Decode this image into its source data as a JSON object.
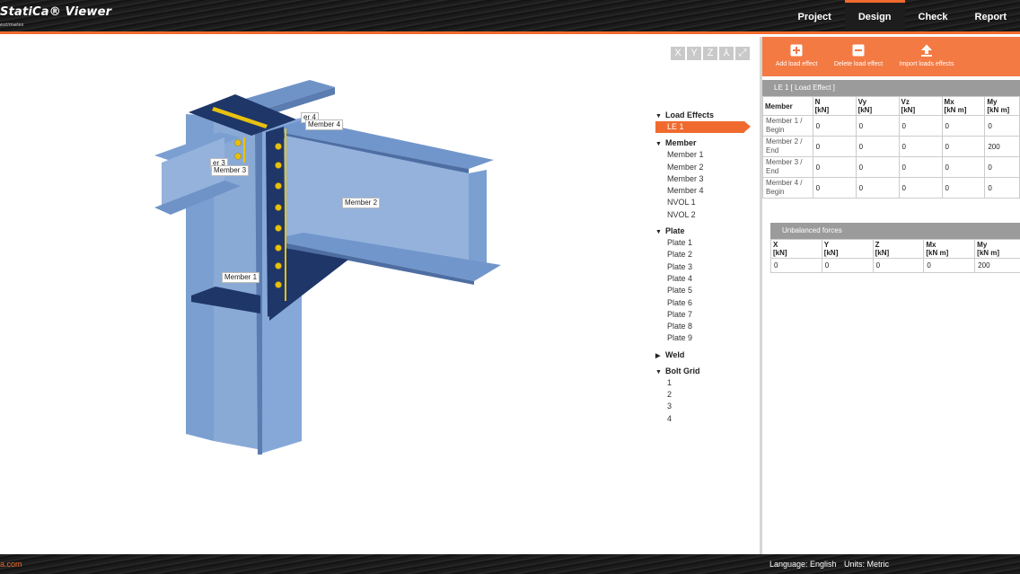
{
  "header": {
    "app_title": "StatiCa® Viewer",
    "tagline": "estimates",
    "tabs": [
      {
        "label": "Project"
      },
      {
        "label": "Design"
      },
      {
        "label": "Check"
      },
      {
        "label": "Report"
      }
    ],
    "active_tab": "Design"
  },
  "viewport": {
    "view_buttons": [
      "X",
      "Y",
      "Z",
      "⅄",
      "⤢"
    ],
    "labels": {
      "member1": "Member 1",
      "member2": "Member 2",
      "member3a": "er 3",
      "member3b": "Member 3",
      "member4a": "er 4",
      "member4b": "Member 4"
    },
    "colors": {
      "beam": "#7b9fd1",
      "beam_dark": "#5a7cb0",
      "plate": "#1f3669",
      "bolt": "#e8c10f"
    }
  },
  "tree": {
    "load_effects": {
      "label": "Load Effects",
      "items": [
        "LE 1"
      ]
    },
    "member": {
      "label": "Member",
      "items": [
        "Member 1",
        "Member 2",
        "Member 3",
        "Member 4",
        "NVOL 1",
        "NVOL 2"
      ]
    },
    "plate": {
      "label": "Plate",
      "items": [
        "Plate 1",
        "Plate 2",
        "Plate 3",
        "Plate 4",
        "Plate 5",
        "Plate 6",
        "Plate 7",
        "Plate 8",
        "Plate 9"
      ]
    },
    "weld": {
      "label": "Weld"
    },
    "bolt_grid": {
      "label": "Bolt Grid",
      "items": [
        "1",
        "2",
        "3",
        "4"
      ]
    }
  },
  "toolbar": {
    "add": "Add load effect",
    "delete": "Delete load effect",
    "import": "Import loads effects"
  },
  "load_effect": {
    "title": "LE   1    [ Load Effect ]",
    "columns": [
      {
        "name": "Member",
        "unit": ""
      },
      {
        "name": "N",
        "unit": "[kN]"
      },
      {
        "name": "Vy",
        "unit": "[kN]"
      },
      {
        "name": "Vz",
        "unit": "[kN]"
      },
      {
        "name": "Mx",
        "unit": "[kN m]"
      },
      {
        "name": "My",
        "unit": "[kN m]"
      }
    ],
    "rows": [
      {
        "member": "Member 1 / Begin",
        "values": [
          "0",
          "0",
          "0",
          "0",
          "0"
        ]
      },
      {
        "member": "Member 2 / End",
        "values": [
          "0",
          "0",
          "0",
          "0",
          "200"
        ]
      },
      {
        "member": "Member 3 / End",
        "values": [
          "0",
          "0",
          "0",
          "0",
          "0"
        ]
      },
      {
        "member": "Member 4 / Begin",
        "values": [
          "0",
          "0",
          "0",
          "0",
          "0"
        ]
      }
    ]
  },
  "unbalanced": {
    "title": "Unbalanced    forces",
    "columns": [
      {
        "name": "X",
        "unit": "[kN]"
      },
      {
        "name": "Y",
        "unit": "[kN]"
      },
      {
        "name": "Z",
        "unit": "[kN]"
      },
      {
        "name": "Mx",
        "unit": "[kN m]"
      },
      {
        "name": "My",
        "unit": "[kN m]"
      }
    ],
    "values": [
      "0",
      "0",
      "0",
      "0",
      "200"
    ]
  },
  "footer": {
    "site_prefix": "",
    "site_accent": "a.com",
    "language": "Language: English",
    "units": "Units: Metric"
  }
}
